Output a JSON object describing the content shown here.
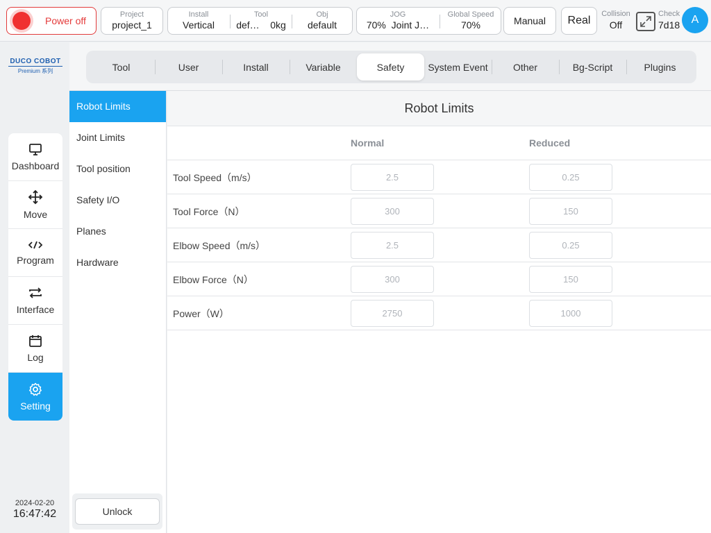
{
  "topbar": {
    "power_label": "Power off",
    "project": {
      "label": "Project",
      "value": "project_1"
    },
    "install": {
      "label": "Install",
      "value": "Vertical"
    },
    "tool": {
      "label": "Tool",
      "name": "def…",
      "weight": "0kg"
    },
    "obj": {
      "label": "Obj",
      "value": "default"
    },
    "jog": {
      "label": "JOG",
      "percent": "70%",
      "mode": "Joint J…"
    },
    "global_speed": {
      "label": "Global Speed",
      "value": "70%"
    },
    "mode_button": "Manual",
    "real_button": "Real",
    "collision": {
      "label": "Collision",
      "value": "Off"
    },
    "check": {
      "label": "Check",
      "value": "7d18"
    },
    "avatar": "A"
  },
  "logo": {
    "brand": "DUCO COBOT",
    "series": "Premium 系列"
  },
  "nav": [
    {
      "label": "Dashboard",
      "icon": "monitor-icon"
    },
    {
      "label": "Move",
      "icon": "move-icon"
    },
    {
      "label": "Program",
      "icon": "code-icon"
    },
    {
      "label": "Interface",
      "icon": "swap-icon"
    },
    {
      "label": "Log",
      "icon": "calendar-icon"
    },
    {
      "label": "Setting",
      "icon": "gear-icon",
      "active": true
    }
  ],
  "clock": {
    "date": "2024-02-20",
    "time": "16:47:42"
  },
  "tabs": [
    "Tool",
    "User",
    "Install",
    "Variable",
    "Safety",
    "System Event",
    "Other",
    "Bg-Script",
    "Plugins"
  ],
  "active_tab": "Safety",
  "subnav": [
    "Robot Limits",
    "Joint Limits",
    "Tool position",
    "Safety I/O",
    "Planes",
    "Hardware"
  ],
  "active_subnav": "Robot Limits",
  "unlock_label": "Unlock",
  "content": {
    "title": "Robot Limits",
    "col_normal": "Normal",
    "col_reduced": "Reduced",
    "rows": [
      {
        "label": "Tool Speed（m/s）",
        "normal": "2.5",
        "reduced": "0.25"
      },
      {
        "label": "Tool Force（N）",
        "normal": "300",
        "reduced": "150"
      },
      {
        "label": "Elbow Speed（m/s）",
        "normal": "2.5",
        "reduced": "0.25"
      },
      {
        "label": "Elbow Force（N）",
        "normal": "300",
        "reduced": "150"
      },
      {
        "label": "Power（W）",
        "normal": "2750",
        "reduced": "1000"
      }
    ]
  },
  "colors": {
    "accent": "#1aa3f0",
    "power_red": "#e43a3a"
  }
}
